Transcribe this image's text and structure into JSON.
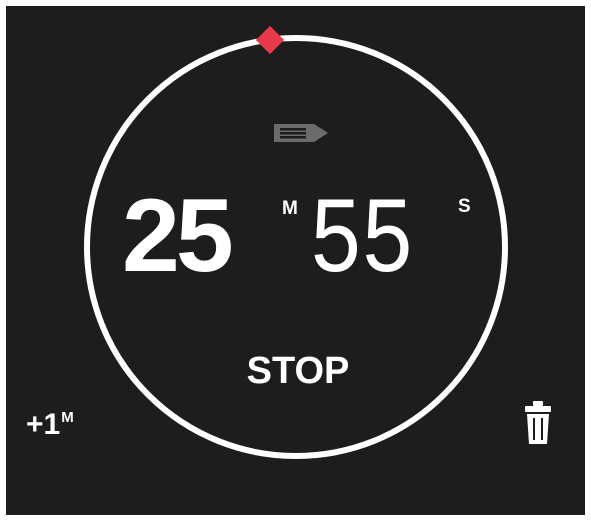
{
  "timer": {
    "minutes": "25",
    "minutes_unit": "M",
    "seconds": "55",
    "seconds_unit": "S",
    "progress_fraction": 0.99
  },
  "controls": {
    "stop_label": "STOP",
    "add_minute_label": "+1",
    "add_minute_unit": "M"
  },
  "icons": {
    "label": "label-tag-icon",
    "delete": "trash-icon",
    "progress_marker": "diamond-marker-icon"
  },
  "colors": {
    "background": "#1d1d1d",
    "ring": "#ffffff",
    "marker": "#e8394a",
    "label_icon": "#6b6b6b",
    "text": "#ffffff"
  }
}
